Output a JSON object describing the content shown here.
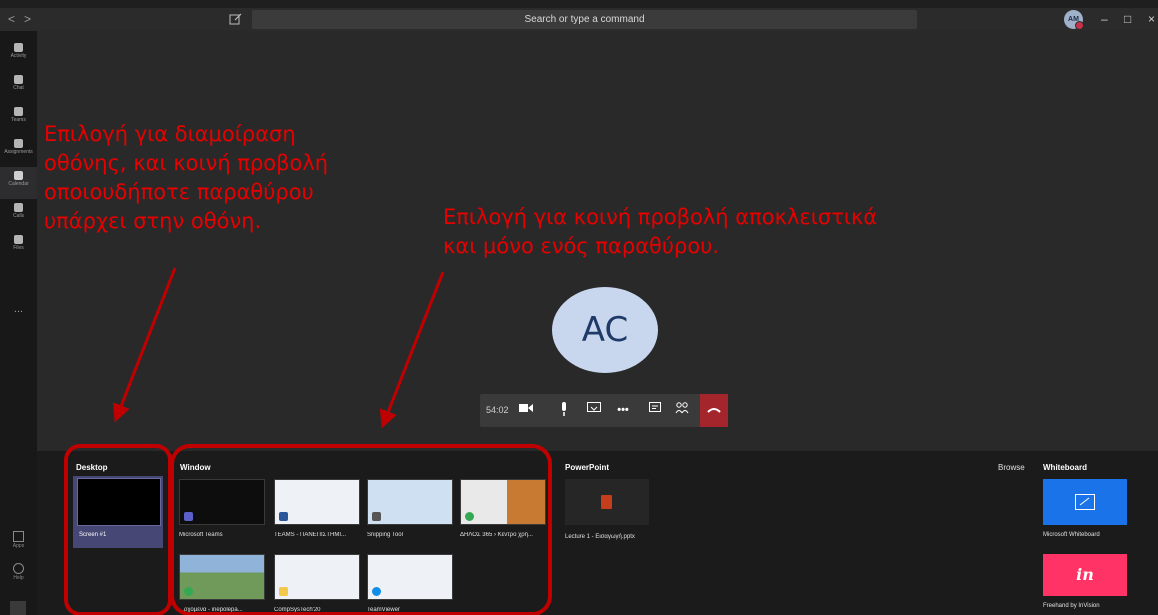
{
  "titlebar": {
    "back": "<",
    "forward": ">",
    "search_placeholder": "Search or type a command",
    "avatar_initials": "AM",
    "minimize": "–",
    "maximize": "□",
    "close": "×"
  },
  "rail": {
    "items": [
      {
        "label": "Activity",
        "icon": "bell-icon"
      },
      {
        "label": "Chat",
        "icon": "chat-icon"
      },
      {
        "label": "Teams",
        "icon": "teams-icon"
      },
      {
        "label": "Assignments",
        "icon": "assignments-icon"
      },
      {
        "label": "Calendar",
        "icon": "calendar-icon"
      },
      {
        "label": "Calls",
        "icon": "phone-icon"
      },
      {
        "label": "Files",
        "icon": "files-icon"
      }
    ],
    "more": "...",
    "apps": "Apps",
    "help": "Help"
  },
  "call": {
    "participant_initials": "AC",
    "timer": "54:02"
  },
  "tray": {
    "desktop": {
      "title": "Desktop",
      "screen_label": "Screen #1"
    },
    "window": {
      "title": "Window",
      "items": [
        {
          "label": "Microsoft Teams"
        },
        {
          "label": "TEAMS - ΠΑΝΕΠΙΣΤΗΜΙ..."
        },
        {
          "label": "Snipping Tool"
        },
        {
          "label": "ΔΗΛΟΣ 365 › Κέντρο χρή..."
        },
        {
          "label": "...ρχόμενα - inepolepa..."
        },
        {
          "label": "CompSysTech'20"
        },
        {
          "label": "TeamViewer"
        }
      ]
    },
    "powerpoint": {
      "title": "PowerPoint",
      "file": "Lecture 1 - Εισαγωγή.pptx"
    },
    "browse": "Browse",
    "whiteboard": {
      "title": "Whiteboard",
      "items": [
        {
          "label": "Microsoft Whiteboard"
        },
        {
          "label": "Freehand by InVision"
        }
      ],
      "invision_logo": "in"
    }
  },
  "annotations": {
    "left": [
      "Επιλογή για διαμοίραση",
      "οθόνης, και κοινή προβολή",
      "οποιουδήποτε παραθύρου",
      "υπάρχει στην οθόνη."
    ],
    "right": [
      "Επιλογή για κοινή προβολή αποκλειστικά",
      "και μόνο ενός παραθύρου."
    ]
  },
  "colors": {
    "annotation": "#e60000",
    "annotation_outline": "#c00000",
    "hangup": "#a4262c",
    "selected": "#464775"
  }
}
